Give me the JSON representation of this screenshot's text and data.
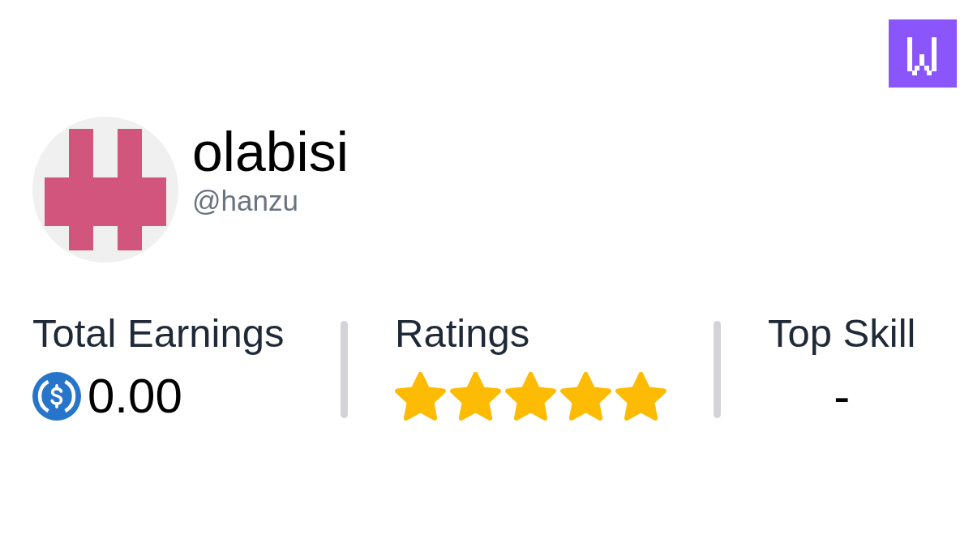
{
  "profile": {
    "name": "olabisi",
    "handle": "@hanzu"
  },
  "stats": [
    {
      "kind": "amount",
      "label": "Total Earnings",
      "value": "0.00"
    },
    {
      "kind": "rating",
      "label": "Ratings",
      "stars": 5
    },
    {
      "kind": "text",
      "label": "Top Skill",
      "value": "-"
    }
  ]
}
